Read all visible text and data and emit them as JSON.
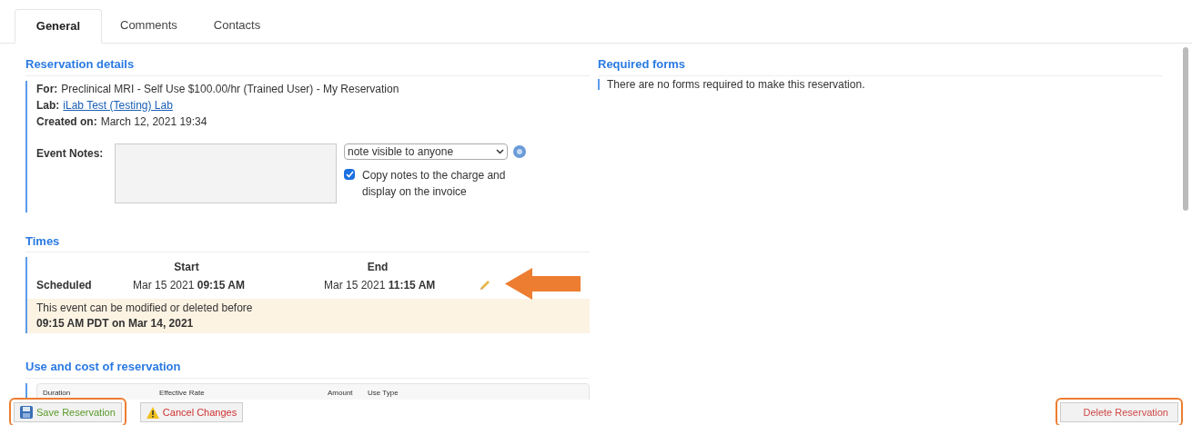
{
  "tabs": [
    {
      "label": "General",
      "selected": true
    },
    {
      "label": "Comments",
      "selected": false
    },
    {
      "label": "Contacts",
      "selected": false
    }
  ],
  "reservation_details": {
    "heading": "Reservation details",
    "fields": [
      {
        "label": "For:",
        "value": "Preclinical MRI - Self Use $100.00/hr (Trained User) - My Reservation",
        "kind": "text"
      },
      {
        "label": "Lab:",
        "value": "iLab Test (Testing) Lab",
        "kind": "link"
      },
      {
        "label": "Created on:",
        "value": "March 12, 2021 19:34",
        "kind": "text"
      }
    ],
    "event_notes": {
      "label": "Event Notes:",
      "visibility": "note visible to anyone",
      "copy_notes": {
        "label": "Copy notes to the charge and display on the invoice",
        "checked": true
      }
    }
  },
  "times": {
    "heading": "Times",
    "columns": [
      "Start",
      "End"
    ],
    "rows": [
      {
        "label": "Scheduled",
        "start": "Mar 15 2021 **09:15 AM**",
        "end": "Mar 15 2021 **11:15 AM**"
      }
    ],
    "notice": {
      "text": "This event can be modified or deleted before",
      "deadline": "09:15 AM PDT on Mar 14, 2021"
    }
  },
  "use_and_cost": {
    "heading": "Use and cost of reservation",
    "columns": [
      "Duration",
      "Effective Rate",
      "Amount",
      "Use Type"
    ]
  },
  "required_forms": {
    "heading": "Required forms",
    "message": "There are no forms required to make this reservation."
  },
  "buttons": [
    {
      "label": "Save Reservation",
      "kind": "save",
      "highlighted": true
    },
    {
      "label": "Cancel Changes",
      "kind": "cancel",
      "highlighted": false
    },
    {
      "label": "Delete Reservation",
      "kind": "delete",
      "highlighted": true
    }
  ]
}
